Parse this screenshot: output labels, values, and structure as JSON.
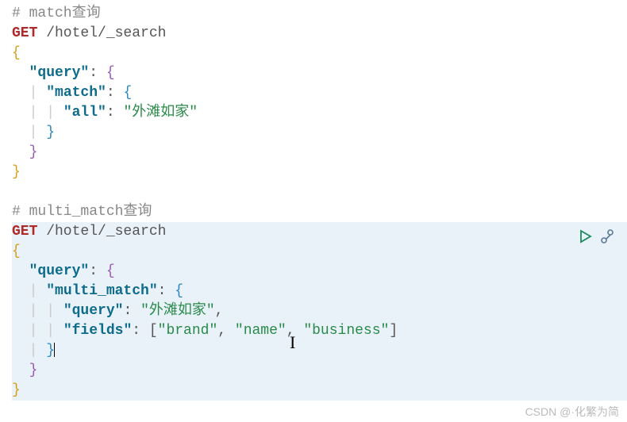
{
  "code": {
    "comment1": "# match查询",
    "method1": "GET",
    "path1": " /hotel/_search",
    "brace_open": "{",
    "brace_close": "}",
    "query_key": "\"query\"",
    "colon_brace": ": {",
    "match_key": "\"match\"",
    "all_key": "\"all\"",
    "colon": ": ",
    "all_value": "\"外滩如家\"",
    "comment2": "# multi_match查询",
    "method2": "GET",
    "path2": " /hotel/_search",
    "multi_match_key": "\"multi_match\"",
    "mm_query_key": "\"query\"",
    "mm_query_value": "\"外滩如家\"",
    "comma": ",",
    "fields_key": "\"fields\"",
    "colon_bracket": ": [",
    "field1": "\"brand\"",
    "field2": "\"name\"",
    "field3": "\"business\"",
    "bracket_close": "]",
    "comma_sep": ", "
  },
  "watermark": "CSDN @·化繁为简"
}
